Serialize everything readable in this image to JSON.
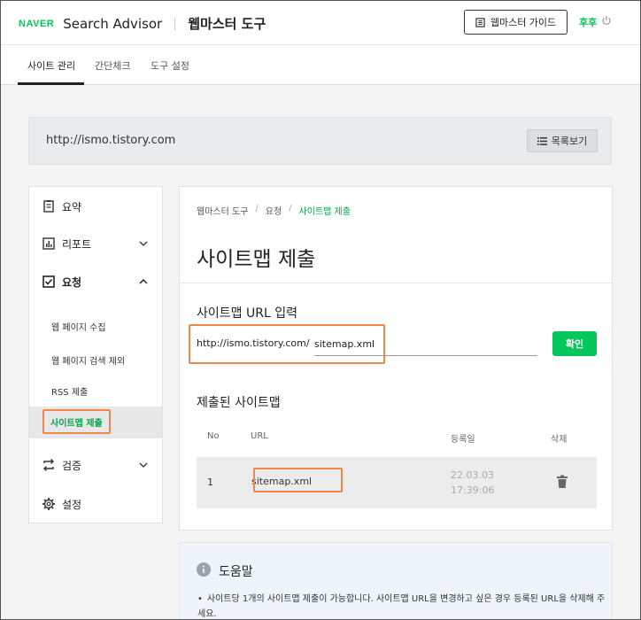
{
  "header": {
    "logo": "NAVER",
    "app_name": "Search Advisor",
    "tool_name": "웹마스터 도구",
    "guide_label": "웹마스터 가이드",
    "user_name": "후후"
  },
  "tabs": [
    {
      "label": "사이트 관리",
      "active": true
    },
    {
      "label": "간단체크",
      "active": false
    },
    {
      "label": "도구 설정",
      "active": false
    }
  ],
  "site": {
    "url": "http://ismo.tistory.com",
    "list_label": "목록보기"
  },
  "sidebar": {
    "items": [
      {
        "label": "요약",
        "icon": "summary-icon"
      },
      {
        "label": "리포트",
        "icon": "report-icon"
      },
      {
        "label": "요청",
        "icon": "request-check-icon"
      },
      {
        "label": "검증",
        "icon": "verify-arrows-icon"
      },
      {
        "label": "설정",
        "icon": "gear-icon"
      }
    ],
    "sub_items": [
      {
        "label": "웹 페이지 수집"
      },
      {
        "label": "웹 페이지 검색 제외"
      },
      {
        "label": "RSS 제출"
      },
      {
        "label": "사이트맵 제출",
        "active": true
      }
    ]
  },
  "main": {
    "breadcrumb": [
      "웹마스터 도구",
      "요청",
      "사이트맵 제출"
    ],
    "title": "사이트맵 제출",
    "url_section_title": "사이트맵 URL 입력",
    "url_prefix": "http://ismo.tistory.com/",
    "input_value": "sitemap.xml",
    "confirm_label": "확인",
    "submitted_title": "제출된 사이트맵",
    "table": {
      "headers": [
        "No",
        "URL",
        "등록일",
        "삭제"
      ],
      "rows": [
        {
          "no": "1",
          "url": "sitemap.xml",
          "date": "22.03.03 17:39:06"
        }
      ]
    }
  },
  "help": {
    "title": "도움말",
    "text": "사이트당 1개의 사이트맵 제출이 가능합니다. 사이트맵 URL을 변경하고 싶은 경우 등록된 URL을 삭제해 주세요."
  },
  "colors": {
    "accent": "#03c75a",
    "highlight": "#f0874a"
  }
}
